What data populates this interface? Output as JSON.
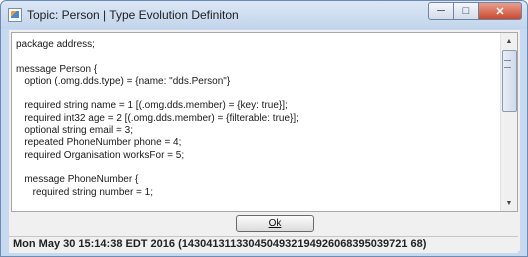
{
  "window": {
    "title": "Topic: Person | Type Evolution Definiton",
    "icon": "java-app-icon",
    "controls": {
      "minimize_icon": "minimize-icon",
      "maximize_icon": "maximize-icon",
      "close_icon": "close-icon"
    }
  },
  "editor": {
    "lines": [
      "package address;",
      "",
      "message Person {",
      "   option (.omg.dds.type) = {name: \"dds.Person\"}",
      "",
      "   required string name = 1 [(.omg.dds.member) = {key: true}];",
      "   required int32 age = 2 [(.omg.dds.member) = {filterable: true}];",
      "   optional string email = 3;",
      "   repeated PhoneNumber phone = 4;",
      "   required Organisation worksFor = 5;",
      "",
      "   message PhoneNumber {",
      "      required string number = 1;"
    ]
  },
  "ok_button": {
    "label": "Ok"
  },
  "status": {
    "text": "Mon May 30 15:14:38 EDT 2016 (1430413113304504932194926068395039721 68)"
  },
  "colors": {
    "title_bar": "#c2d5ec",
    "close_button": "#c84a2e",
    "background": "#f0f0f0"
  }
}
